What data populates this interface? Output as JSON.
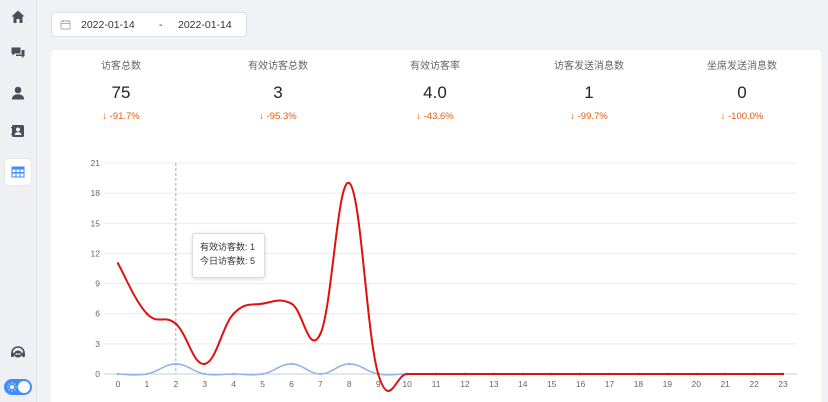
{
  "sidebar": {
    "items": [
      {
        "name": "home",
        "icon": "home-icon"
      },
      {
        "name": "messages",
        "icon": "chat-bubbles-icon"
      },
      {
        "name": "user",
        "icon": "user-icon"
      },
      {
        "name": "contacts",
        "icon": "contact-card-icon"
      },
      {
        "name": "table",
        "icon": "table-grid-icon",
        "active": true
      }
    ],
    "bottom": {
      "icon": "customer-service-icon",
      "toggle": {
        "on": true,
        "icon": "sun-icon"
      }
    },
    "accent_color": "#3f8cff"
  },
  "date_range": {
    "start": "2022-01-14",
    "separator": "-",
    "end": "2022-01-14"
  },
  "stats": [
    {
      "label": "访客总数",
      "value": "75",
      "change": "↓ -91.7%"
    },
    {
      "label": "有效访客总数",
      "value": "3",
      "change": "↓ -95.3%"
    },
    {
      "label": "有效访客率",
      "value": "4.0",
      "change": "↓ -43.6%"
    },
    {
      "label": "访客发送消息数",
      "value": "1",
      "change": "↓ -99.7%"
    },
    {
      "label": "坐席发送消息数",
      "value": "0",
      "change": "↓ -100.0%"
    }
  ],
  "chart_data": {
    "type": "line",
    "x": [
      0,
      1,
      2,
      3,
      4,
      5,
      6,
      7,
      8,
      9,
      10,
      11,
      12,
      13,
      14,
      15,
      16,
      17,
      18,
      19,
      20,
      21,
      22,
      23
    ],
    "series": [
      {
        "color": "#e01010",
        "values": [
          11,
          6,
          5,
          1,
          6,
          7,
          7,
          4,
          19,
          0,
          0,
          0,
          0,
          0,
          0,
          0,
          0,
          0,
          0,
          0,
          0,
          0,
          0,
          0
        ]
      },
      {
        "color": "#8fb4ee",
        "values": [
          0,
          0,
          1,
          0,
          0,
          0,
          1,
          0,
          1,
          0,
          0,
          0,
          0,
          0,
          0,
          0,
          0,
          0,
          0,
          0,
          0,
          0,
          0,
          0
        ]
      }
    ],
    "yticks": [
      0,
      3,
      6,
      9,
      12,
      15,
      18,
      21
    ],
    "ylim": [
      0,
      21
    ],
    "grid": true,
    "tooltip": {
      "x": 2,
      "lines": [
        "有效访客数: 1",
        "今日访客数: 5"
      ]
    }
  }
}
